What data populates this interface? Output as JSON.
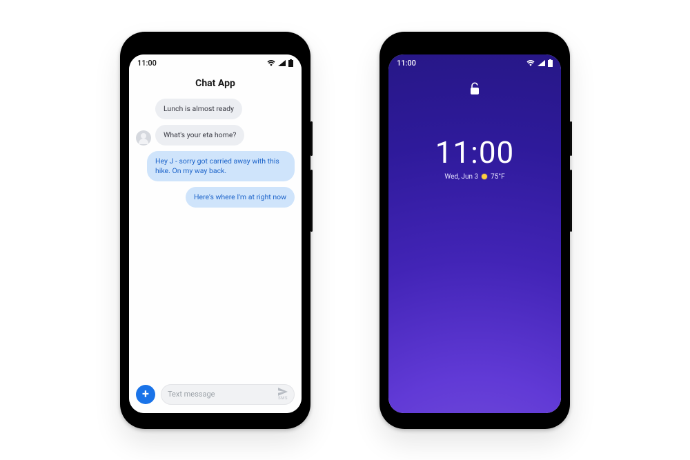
{
  "left_phone": {
    "statusbar": {
      "time": "11:00"
    },
    "app_title": "Chat App",
    "messages": [
      {
        "direction": "in",
        "text": "Lunch is almost ready",
        "show_avatar": false
      },
      {
        "direction": "in",
        "text": "What's your eta home?",
        "show_avatar": true
      },
      {
        "direction": "out",
        "text": "Hey J - sorry got carried away with this hike. On my way back."
      },
      {
        "direction": "out",
        "text": "Here's where I'm at right now"
      }
    ],
    "composer": {
      "placeholder": "Text message",
      "add_button": "+",
      "send_label": "SMS"
    }
  },
  "right_phone": {
    "statusbar": {
      "time": "11:00"
    },
    "lock": {
      "clock": "11:00",
      "date": "Wed, Jun 3",
      "temperature": "75°F"
    }
  },
  "icons": {
    "signal": "signal-icon",
    "wifi": "wifi-icon",
    "battery": "battery-icon",
    "unlock": "unlock-icon",
    "send": "send-icon",
    "avatar": "avatar-icon",
    "sun": "sun-icon",
    "plus": "plus-icon"
  }
}
